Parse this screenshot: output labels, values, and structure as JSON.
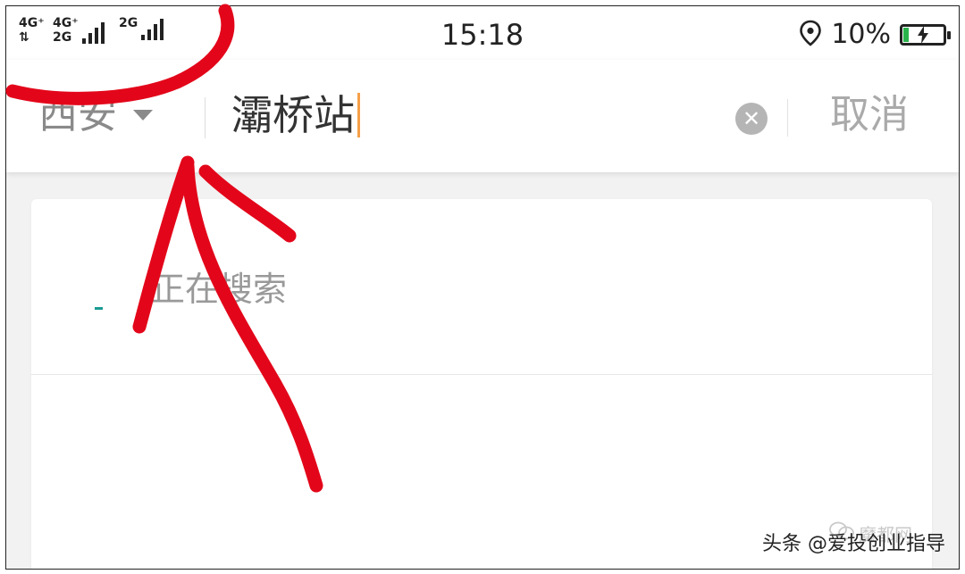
{
  "statusbar": {
    "network_1": "4G⁺",
    "network_2": "4G⁺",
    "network_3": "2G",
    "network_4": "2G",
    "time": "15:18",
    "battery_percent": "10%",
    "battery_level": 0.1,
    "icons": [
      "location-icon",
      "battery-charging-icon"
    ]
  },
  "search": {
    "city": "西安",
    "query": "灞桥站",
    "cancel_label": "取消",
    "clear_icon": "close-circle-icon"
  },
  "results": {
    "status_text": "正在搜索"
  },
  "watermark": {
    "logo_text": "魔都网",
    "credit": "头条 @爱投创业指导"
  },
  "colors": {
    "annotation_red": "#e3061a",
    "cursor_orange": "#f5a04a",
    "spinner_teal": "#1a9a93",
    "background_gray": "#f2f2f2"
  }
}
